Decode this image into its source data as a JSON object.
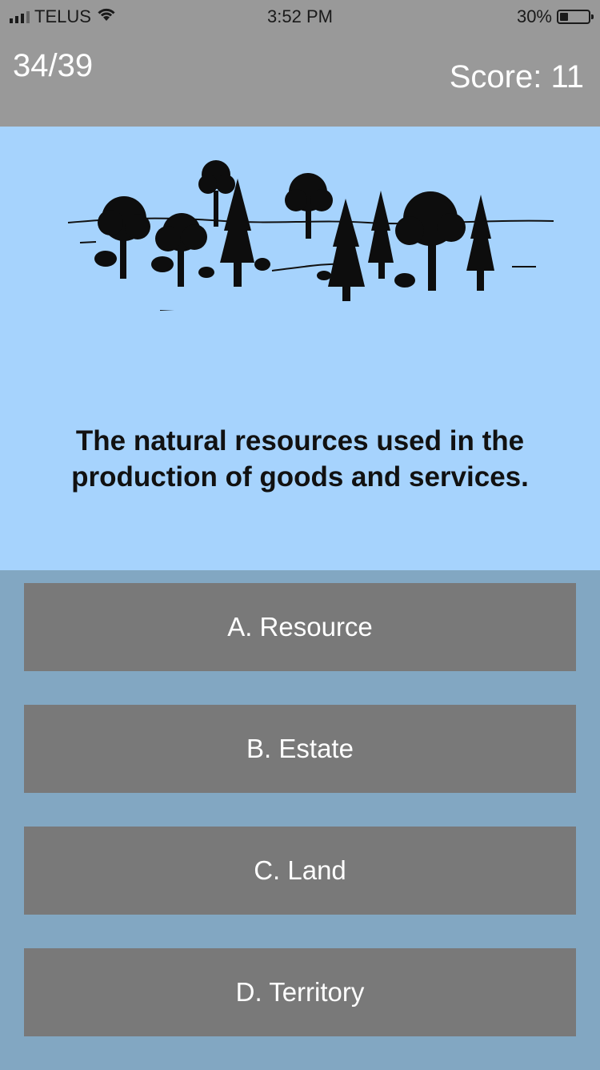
{
  "status_bar": {
    "carrier": "TELUS",
    "time": "3:52 PM",
    "battery": "30%",
    "battery_level": 0.3
  },
  "header": {
    "progress": "34/39",
    "score": "Score: 11"
  },
  "question": {
    "text": "The natural resources used in the production of goods and services.",
    "image": "forest-trees-illustration"
  },
  "answers": [
    {
      "label": "A. Resource"
    },
    {
      "label": "B. Estate"
    },
    {
      "label": "C. Land"
    },
    {
      "label": "D. Territory"
    }
  ],
  "colors": {
    "header_bg": "#999999",
    "question_bg": "#a6d3fd",
    "answers_bg": "#82a7c2",
    "button_bg": "#797979"
  }
}
